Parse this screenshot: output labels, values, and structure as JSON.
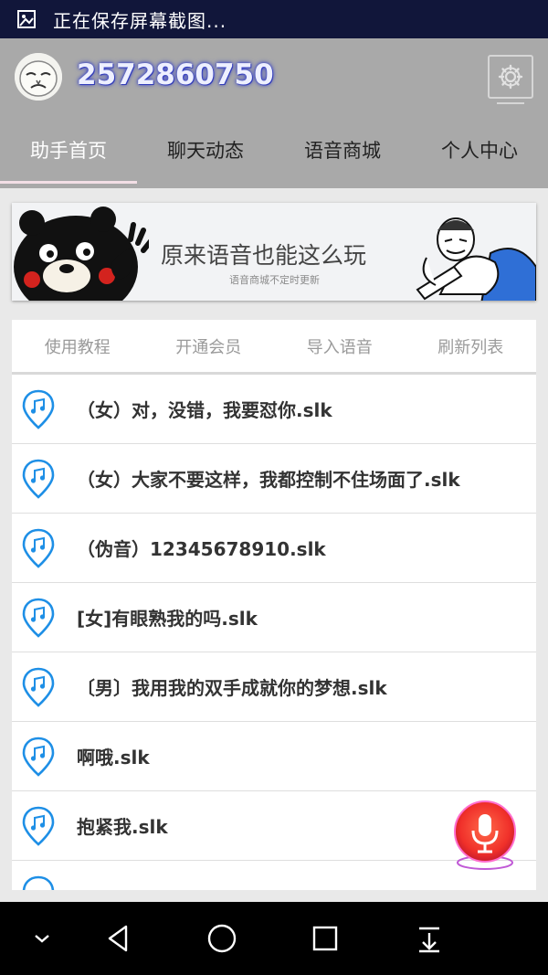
{
  "status_bar": {
    "text": "正在保存屏幕截图..."
  },
  "header": {
    "user_id": "2572860750"
  },
  "tabs": [
    {
      "label": "助手首页",
      "active": true
    },
    {
      "label": "聊天动态",
      "active": false
    },
    {
      "label": "语音商城",
      "active": false
    },
    {
      "label": "个人中心",
      "active": false
    }
  ],
  "banner": {
    "title": "原来语音也能这么玩",
    "subtitle": "语音商城不定时更新"
  },
  "actions": [
    {
      "label": "使用教程"
    },
    {
      "label": "开通会员"
    },
    {
      "label": "导入语音"
    },
    {
      "label": "刷新列表"
    }
  ],
  "voice_list": [
    {
      "name": "（女）对，没错，我要怼你.slk"
    },
    {
      "name": "（女）大家不要这样，我都控制不住场面了.slk"
    },
    {
      "name": "（伪音）12345678910.slk"
    },
    {
      "name": "[女]有眼熟我的吗.slk"
    },
    {
      "name": "〔男〕我用我的双手成就你的梦想.slk"
    },
    {
      "name": "啊哦.slk"
    },
    {
      "name": "抱紧我.slk"
    }
  ],
  "colors": {
    "status_bar": "#11163a",
    "header": "#a9a9a9",
    "accent_blue": "#1e8fe6",
    "fab_red": "#ff3b3b"
  },
  "icons": [
    "screenshot-icon",
    "avatar",
    "gear-icon",
    "music-pin-icon",
    "microphone-icon",
    "back-icon",
    "home-icon",
    "recents-icon",
    "collapse-icon",
    "notification-pull-icon"
  ]
}
